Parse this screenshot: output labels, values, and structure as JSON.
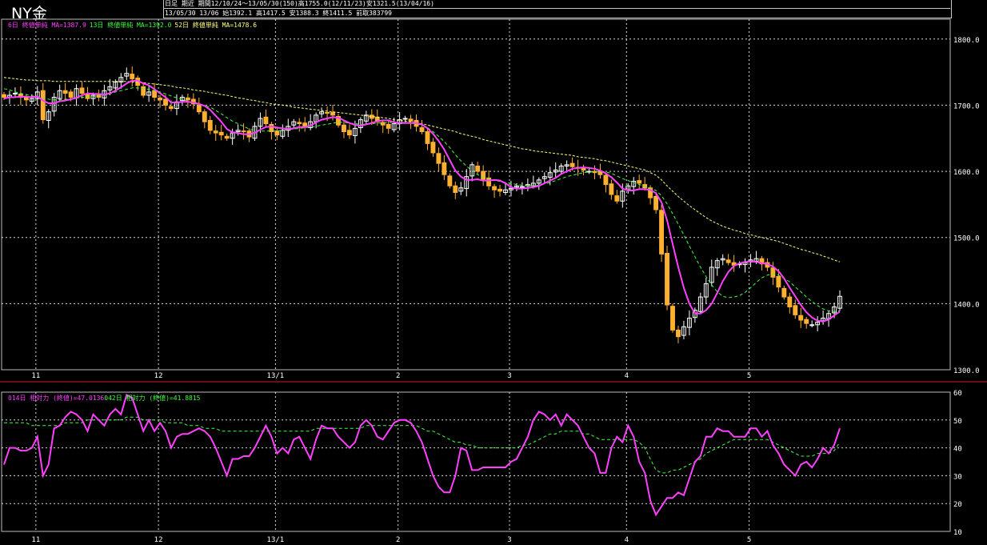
{
  "header": {
    "instrument": "NY金",
    "info_line1": "日足 期近 期間12/10/24～13/05/30(150)高1755.0(12/11/23)安1321.5(13/04/16)",
    "info_line2": "13/05/30 13/06 始1392.1 高1417.5 安1388.3 終1411.5 前取383799"
  },
  "colors": {
    "background": "#000000",
    "candle_up": "#ffffff",
    "candle_down": "#ffb030",
    "ma1": "#ff40ff",
    "ma2": "#40ff40",
    "ma3": "#ffff80",
    "rsi1": "#ff40ff",
    "rsi2": "#40ff40",
    "divider": "#cc2222"
  },
  "chart_data": [
    {
      "type": "candlestick",
      "legend": [
        {
          "text": "6日 終値単純 MA=1387.9",
          "color": "#ff40ff"
        },
        {
          "text": "13日 終値単純 MA=1392.0",
          "color": "#40ff40"
        },
        {
          "text": "52日 終値単純 MA=1478.6",
          "color": "#ffff80"
        }
      ],
      "ylim": [
        1300,
        1830
      ],
      "y_ticks": [
        1300,
        1400,
        1500,
        1600,
        1700,
        1800
      ],
      "y_tick_labels": [
        "1300.0",
        "1400.0",
        "1500.0",
        "1600.0",
        "1700.0",
        "1800.0"
      ],
      "x_ticks": [
        {
          "label": "11",
          "index": 5
        },
        {
          "label": "12",
          "index": 27
        },
        {
          "label": "13/1",
          "index": 48
        },
        {
          "label": "2",
          "index": 70
        },
        {
          "label": "3",
          "index": 90
        },
        {
          "label": "4",
          "index": 111
        },
        {
          "label": "5",
          "index": 133
        }
      ],
      "close_values": [
        1712,
        1715,
        1718,
        1712,
        1708,
        1710,
        1720,
        1678,
        1690,
        1712,
        1722,
        1718,
        1712,
        1725,
        1718,
        1710,
        1715,
        1712,
        1722,
        1728,
        1735,
        1742,
        1748,
        1740,
        1730,
        1715,
        1720,
        1712,
        1708,
        1700,
        1695,
        1705,
        1712,
        1708,
        1702,
        1690,
        1675,
        1662,
        1658,
        1655,
        1650,
        1658,
        1662,
        1660,
        1652,
        1668,
        1680,
        1672,
        1660,
        1655,
        1662,
        1668,
        1675,
        1672,
        1668,
        1675,
        1685,
        1690,
        1688,
        1685,
        1670,
        1660,
        1655,
        1665,
        1678,
        1685,
        1680,
        1675,
        1670,
        1665,
        1672,
        1678,
        1680,
        1676,
        1668,
        1660,
        1642,
        1628,
        1612,
        1595,
        1578,
        1568,
        1575,
        1592,
        1610,
        1600,
        1588,
        1578,
        1572,
        1570,
        1572,
        1574,
        1578,
        1577,
        1580,
        1582,
        1587,
        1592,
        1598,
        1602,
        1608,
        1610,
        1607,
        1605,
        1602,
        1600,
        1598,
        1595,
        1580,
        1565,
        1555,
        1570,
        1578,
        1585,
        1582,
        1575,
        1560,
        1542,
        1475,
        1398,
        1360,
        1350,
        1365,
        1378,
        1390,
        1410,
        1430,
        1455,
        1465,
        1468,
        1462,
        1458,
        1460,
        1462,
        1466,
        1468,
        1460,
        1455,
        1440,
        1425,
        1410,
        1395,
        1383,
        1375,
        1370,
        1368,
        1372,
        1378,
        1385,
        1395,
        1411
      ],
      "ma_6": [
        1710,
        1712,
        1712,
        1713,
        1713,
        1712,
        1713,
        1707,
        1703,
        1703,
        1706,
        1707,
        1709,
        1711,
        1715,
        1718,
        1717,
        1717,
        1716,
        1718,
        1722,
        1727,
        1733,
        1737,
        1737,
        1733,
        1730,
        1724,
        1718,
        1712,
        1704,
        1704,
        1705,
        1705,
        1704,
        1702,
        1699,
        1693,
        1684,
        1675,
        1664,
        1659,
        1658,
        1656,
        1656,
        1658,
        1663,
        1667,
        1668,
        1666,
        1665,
        1664,
        1665,
        1667,
        1667,
        1669,
        1674,
        1678,
        1680,
        1682,
        1681,
        1677,
        1673,
        1670,
        1669,
        1671,
        1673,
        1676,
        1677,
        1677,
        1674,
        1673,
        1673,
        1673,
        1673,
        1671,
        1665,
        1657,
        1646,
        1633,
        1617,
        1601,
        1592,
        1587,
        1587,
        1588,
        1586,
        1586,
        1587,
        1586,
        1582,
        1576,
        1574,
        1574,
        1575,
        1576,
        1578,
        1582,
        1586,
        1590,
        1596,
        1600,
        1604,
        1605,
        1606,
        1605,
        1604,
        1601,
        1597,
        1591,
        1583,
        1574,
        1571,
        1571,
        1573,
        1573,
        1572,
        1567,
        1553,
        1526,
        1490,
        1455,
        1424,
        1400,
        1385,
        1385,
        1390,
        1400,
        1416,
        1434,
        1448,
        1457,
        1461,
        1463,
        1464,
        1463,
        1461,
        1460,
        1456,
        1449,
        1438,
        1424,
        1411,
        1398,
        1387,
        1379,
        1374,
        1373,
        1376,
        1382,
        1388
      ],
      "ma_13": [
        1725,
        1723,
        1720,
        1718,
        1716,
        1714,
        1713,
        1711,
        1709,
        1708,
        1708,
        1709,
        1710,
        1711,
        1712,
        1712,
        1713,
        1714,
        1715,
        1717,
        1720,
        1722,
        1724,
        1726,
        1726,
        1725,
        1724,
        1722,
        1720,
        1717,
        1714,
        1711,
        1709,
        1706,
        1703,
        1701,
        1699,
        1697,
        1692,
        1687,
        1681,
        1676,
        1672,
        1668,
        1664,
        1662,
        1661,
        1661,
        1661,
        1661,
        1662,
        1663,
        1664,
        1665,
        1666,
        1667,
        1668,
        1670,
        1671,
        1673,
        1674,
        1674,
        1673,
        1672,
        1671,
        1671,
        1672,
        1673,
        1673,
        1674,
        1674,
        1674,
        1674,
        1673,
        1672,
        1670,
        1666,
        1660,
        1653,
        1645,
        1636,
        1625,
        1616,
        1608,
        1601,
        1595,
        1591,
        1588,
        1586,
        1585,
        1583,
        1582,
        1580,
        1579,
        1578,
        1578,
        1579,
        1581,
        1583,
        1586,
        1589,
        1592,
        1594,
        1596,
        1598,
        1599,
        1600,
        1600,
        1599,
        1597,
        1593,
        1589,
        1586,
        1583,
        1580,
        1578,
        1575,
        1571,
        1563,
        1551,
        1536,
        1520,
        1504,
        1487,
        1471,
        1455,
        1441,
        1428,
        1418,
        1411,
        1409,
        1410,
        1412,
        1417,
        1424,
        1432,
        1439,
        1443,
        1445,
        1443,
        1438,
        1433,
        1425,
        1418,
        1410,
        1403,
        1397,
        1392,
        1389,
        1388,
        1389
      ],
      "ma_52": [
        1742,
        1741,
        1740,
        1739,
        1738,
        1738,
        1737,
        1737,
        1737,
        1736,
        1736,
        1736,
        1736,
        1736,
        1736,
        1736,
        1736,
        1736,
        1736,
        1736,
        1736,
        1736,
        1736,
        1735,
        1735,
        1734,
        1733,
        1732,
        1731,
        1730,
        1729,
        1727,
        1726,
        1725,
        1723,
        1722,
        1721,
        1719,
        1718,
        1716,
        1715,
        1713,
        1711,
        1710,
        1708,
        1707,
        1705,
        1704,
        1702,
        1701,
        1700,
        1699,
        1697,
        1696,
        1695,
        1694,
        1693,
        1692,
        1691,
        1690,
        1689,
        1688,
        1687,
        1686,
        1685,
        1684,
        1683,
        1682,
        1681,
        1680,
        1678,
        1677,
        1676,
        1675,
        1673,
        1672,
        1670,
        1668,
        1666,
        1664,
        1662,
        1660,
        1657,
        1655,
        1653,
        1651,
        1648,
        1646,
        1644,
        1642,
        1640,
        1638,
        1636,
        1634,
        1633,
        1631,
        1630,
        1629,
        1628,
        1627,
        1626,
        1625,
        1624,
        1622,
        1621,
        1620,
        1619,
        1617,
        1616,
        1614,
        1612,
        1610,
        1608,
        1606,
        1604,
        1602,
        1598,
        1594,
        1587,
        1578,
        1570,
        1562,
        1555,
        1548,
        1542,
        1536,
        1530,
        1525,
        1521,
        1517,
        1514,
        1511,
        1509,
        1506,
        1504,
        1502,
        1500,
        1498,
        1496,
        1494,
        1491,
        1488,
        1485,
        1482,
        1480,
        1477,
        1475,
        1472,
        1469,
        1466,
        1463
      ]
    },
    {
      "type": "line",
      "legend": [
        {
          "text": "014日 相対力 (終値)=47.0136",
          "color": "#ff40ff"
        },
        {
          "text": "042日 相対力 (終値)=41.8815",
          "color": "#40ff40"
        }
      ],
      "ylim": [
        10,
        60
      ],
      "y_ticks": [
        10,
        20,
        30,
        40,
        50,
        60
      ],
      "y_tick_labels": [
        "10",
        "20",
        "30",
        "40",
        "50",
        "60"
      ],
      "x_ticks": [
        {
          "label": "11",
          "index": 5
        },
        {
          "label": "12",
          "index": 27
        },
        {
          "label": "13/1",
          "index": 48
        },
        {
          "label": "2",
          "index": 70
        },
        {
          "label": "3",
          "index": 90
        },
        {
          "label": "4",
          "index": 111
        },
        {
          "label": "5",
          "index": 133
        }
      ],
      "series": [
        {
          "name": "014日 相対力 (終値)",
          "values": [
            34,
            40,
            40,
            39,
            39,
            40,
            44,
            30,
            34,
            47,
            48,
            51,
            53,
            52,
            50,
            46,
            52,
            50,
            48,
            52,
            54,
            52,
            59,
            58,
            52,
            46,
            50,
            46,
            49,
            46,
            40,
            44,
            45,
            45,
            46,
            47,
            46,
            44,
            40,
            35,
            30,
            36,
            36,
            37,
            37,
            40,
            44,
            48,
            44,
            38,
            40,
            38,
            43,
            44,
            40,
            36,
            43,
            48,
            47,
            47,
            44,
            42,
            40,
            42,
            48,
            50,
            48,
            44,
            43,
            46,
            49,
            50,
            50,
            49,
            46,
            42,
            36,
            30,
            26,
            24,
            24,
            30,
            40,
            39,
            32,
            32,
            33,
            33,
            33,
            33,
            33,
            35,
            36,
            40,
            44,
            50,
            53,
            52,
            50,
            52,
            48,
            52,
            50,
            48,
            44,
            40,
            38,
            31,
            31,
            40,
            44,
            42,
            48,
            44,
            35,
            31,
            21,
            16,
            19,
            22,
            22,
            24,
            23,
            29,
            35,
            37,
            44,
            44,
            47,
            46,
            46,
            44,
            44,
            44,
            47,
            47,
            44,
            46,
            41,
            38,
            34,
            32,
            30,
            34,
            35,
            33,
            36,
            40,
            38,
            41,
            47
          ]
        },
        {
          "name": "042日 相対力 (終値)",
          "values": [
            49,
            49,
            49,
            49,
            49,
            48,
            48,
            48,
            48,
            48,
            48,
            49,
            49,
            49,
            49,
            50,
            50,
            50,
            50,
            50,
            50,
            50,
            51,
            51,
            51,
            50,
            50,
            50,
            50,
            49,
            49,
            49,
            49,
            48,
            48,
            48,
            47,
            47,
            47,
            46,
            46,
            46,
            46,
            46,
            46,
            46,
            46,
            46,
            46,
            46,
            46,
            46,
            46,
            46,
            46,
            46,
            47,
            47,
            47,
            47,
            47,
            47,
            47,
            47,
            47,
            48,
            48,
            48,
            48,
            48,
            48,
            48,
            48,
            48,
            48,
            47,
            46,
            46,
            45,
            44,
            43,
            42,
            42,
            41,
            41,
            40,
            40,
            40,
            40,
            40,
            40,
            40,
            40,
            41,
            41,
            42,
            43,
            44,
            45,
            45,
            46,
            46,
            46,
            46,
            45,
            45,
            44,
            43,
            43,
            43,
            43,
            43,
            43,
            43,
            42,
            40,
            36,
            32,
            31,
            31,
            32,
            32,
            33,
            34,
            35,
            36,
            38,
            39,
            40,
            41,
            42,
            43,
            43,
            43,
            43,
            43,
            43,
            43,
            42,
            41,
            40,
            39,
            38,
            37,
            37,
            37,
            38,
            38,
            38,
            39,
            42
          ]
        }
      ]
    }
  ]
}
